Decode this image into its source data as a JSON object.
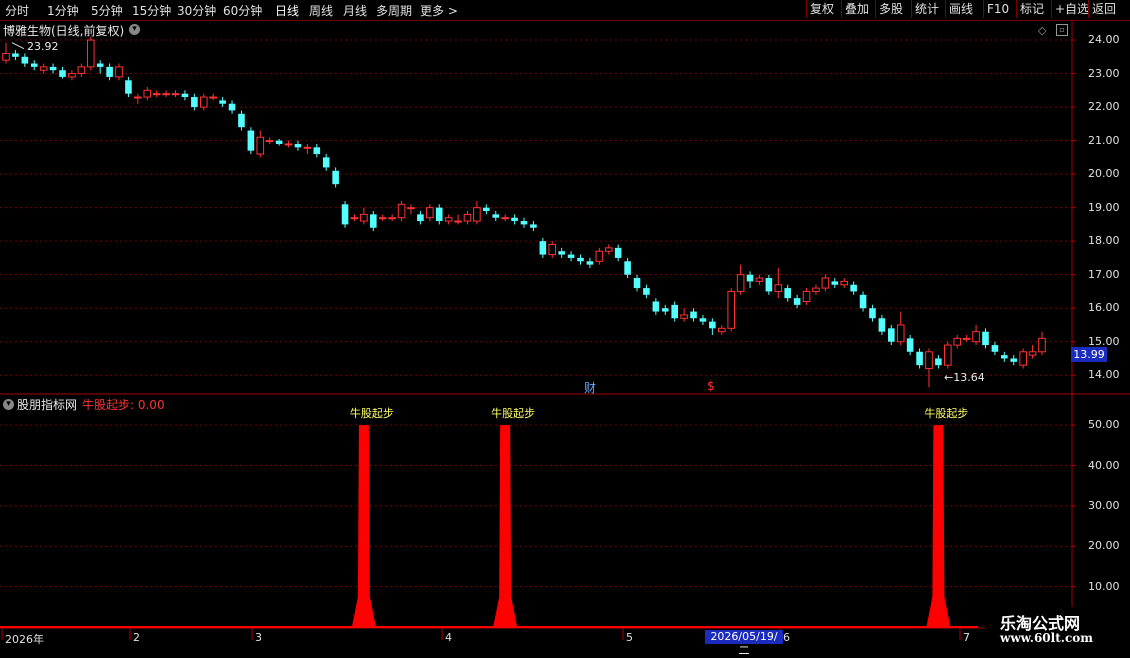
{
  "toolbar": {
    "left_items": [
      "分时",
      "1分钟",
      "5分钟",
      "15分钟",
      "30分钟",
      "60分钟",
      "日线",
      "周线",
      "月线",
      "多周期",
      "更多 >"
    ],
    "active": "日线",
    "right_items": [
      "复权",
      "叠加",
      "多股",
      "统计",
      "画线",
      "F10",
      "标记",
      "+自选",
      "返回"
    ]
  },
  "main_panel": {
    "title": "博雅生物(日线,前复权)",
    "high_marker": "23.92",
    "low_marker": "←13.64",
    "current_price": "13.99",
    "price_ticks": [
      "24.00",
      "23.00",
      "22.00",
      "21.00",
      "20.00",
      "19.00",
      "18.00",
      "17.00",
      "16.00",
      "15.00",
      "14.00"
    ],
    "markers": [
      "财",
      "$"
    ],
    "colors": {
      "up": "#ff3333",
      "down": "#54ffff",
      "grid": "#7a0000"
    }
  },
  "indicator_panel": {
    "name": "股朋指标网",
    "value_label": "牛股起步: 0.00",
    "signal_label": "牛股起步",
    "ticks": [
      "50.00",
      "40.00",
      "30.00",
      "20.00",
      "10.00"
    ],
    "color": "#ff0000"
  },
  "date_axis": {
    "labels": [
      "2026年",
      "2",
      "3",
      "4",
      "5",
      "6",
      "7"
    ],
    "selected": "2026/05/19/二"
  },
  "watermark": {
    "line1": "乐淘公式网",
    "line2": "www.60lt.com"
  },
  "chart_data": {
    "type": "candlestick",
    "ylim": [
      13.5,
      24.3
    ],
    "candles": [
      [
        23.4,
        23.6,
        23.92,
        23.3
      ],
      [
        23.6,
        23.5,
        23.7,
        23.4
      ],
      [
        23.5,
        23.3,
        23.6,
        23.2
      ],
      [
        23.3,
        23.2,
        23.4,
        23.1
      ],
      [
        23.1,
        23.2,
        23.3,
        23.0
      ],
      [
        23.2,
        23.1,
        23.3,
        23.0
      ],
      [
        23.1,
        22.9,
        23.2,
        22.85
      ],
      [
        22.9,
        23.0,
        23.1,
        22.8
      ],
      [
        23.0,
        23.2,
        23.3,
        22.9
      ],
      [
        23.2,
        24.0,
        24.1,
        23.1
      ],
      [
        23.3,
        23.2,
        23.4,
        23.0
      ],
      [
        23.2,
        22.9,
        23.3,
        22.8
      ],
      [
        22.9,
        23.2,
        23.3,
        22.8
      ],
      [
        22.8,
        22.4,
        22.9,
        22.3
      ],
      [
        22.3,
        22.3,
        22.4,
        22.1
      ],
      [
        22.3,
        22.5,
        22.6,
        22.2
      ],
      [
        22.4,
        22.4,
        22.5,
        22.3
      ],
      [
        22.4,
        22.4,
        22.5,
        22.3
      ],
      [
        22.4,
        22.4,
        22.5,
        22.3
      ],
      [
        22.4,
        22.3,
        22.5,
        22.2
      ],
      [
        22.3,
        22.0,
        22.4,
        21.9
      ],
      [
        22.0,
        22.3,
        22.4,
        21.9
      ],
      [
        22.3,
        22.3,
        22.4,
        22.2
      ],
      [
        22.2,
        22.1,
        22.3,
        22.0
      ],
      [
        22.1,
        21.9,
        22.2,
        21.8
      ],
      [
        21.8,
        21.4,
        21.9,
        21.3
      ],
      [
        21.3,
        20.7,
        21.4,
        20.6
      ],
      [
        20.6,
        21.1,
        21.3,
        20.5
      ],
      [
        21.0,
        21.0,
        21.1,
        20.9
      ],
      [
        21.0,
        20.9,
        21.05,
        20.85
      ],
      [
        20.9,
        20.9,
        21.0,
        20.8
      ],
      [
        20.9,
        20.8,
        21.0,
        20.7
      ],
      [
        20.8,
        20.8,
        20.9,
        20.6
      ],
      [
        20.8,
        20.6,
        20.9,
        20.5
      ],
      [
        20.5,
        20.2,
        20.6,
        20.1
      ],
      [
        20.1,
        19.7,
        20.2,
        19.6
      ],
      [
        19.1,
        18.5,
        19.2,
        18.4
      ],
      [
        18.7,
        18.7,
        18.8,
        18.6
      ],
      [
        18.6,
        18.8,
        19.0,
        18.5
      ],
      [
        18.8,
        18.4,
        18.9,
        18.3
      ],
      [
        18.7,
        18.7,
        18.8,
        18.6
      ],
      [
        18.7,
        18.7,
        18.8,
        18.6
      ],
      [
        18.7,
        19.1,
        19.2,
        18.6
      ],
      [
        19.0,
        19.0,
        19.1,
        18.8
      ],
      [
        18.8,
        18.6,
        18.9,
        18.5
      ],
      [
        18.7,
        19.0,
        19.1,
        18.6
      ],
      [
        19.0,
        18.6,
        19.1,
        18.5
      ],
      [
        18.6,
        18.7,
        18.8,
        18.5
      ],
      [
        18.6,
        18.6,
        18.8,
        18.5
      ],
      [
        18.6,
        18.8,
        18.9,
        18.5
      ],
      [
        18.6,
        19.0,
        19.2,
        18.5
      ],
      [
        19.0,
        18.9,
        19.1,
        18.8
      ],
      [
        18.8,
        18.7,
        18.9,
        18.6
      ],
      [
        18.7,
        18.7,
        18.8,
        18.6
      ],
      [
        18.7,
        18.6,
        18.8,
        18.5
      ],
      [
        18.6,
        18.5,
        18.7,
        18.4
      ],
      [
        18.5,
        18.4,
        18.6,
        18.3
      ],
      [
        18.0,
        17.6,
        18.1,
        17.5
      ],
      [
        17.6,
        17.9,
        18.0,
        17.5
      ],
      [
        17.7,
        17.6,
        17.8,
        17.5
      ],
      [
        17.6,
        17.5,
        17.7,
        17.4
      ],
      [
        17.5,
        17.4,
        17.6,
        17.3
      ],
      [
        17.4,
        17.3,
        17.5,
        17.2
      ],
      [
        17.4,
        17.7,
        17.8,
        17.3
      ],
      [
        17.7,
        17.8,
        17.9,
        17.6
      ],
      [
        17.8,
        17.5,
        17.9,
        17.4
      ],
      [
        17.4,
        17.0,
        17.5,
        16.9
      ],
      [
        16.9,
        16.6,
        17.0,
        16.5
      ],
      [
        16.6,
        16.4,
        16.7,
        16.3
      ],
      [
        16.2,
        15.9,
        16.3,
        15.8
      ],
      [
        16.0,
        15.9,
        16.1,
        15.8
      ],
      [
        16.1,
        15.7,
        16.2,
        15.6
      ],
      [
        15.7,
        15.8,
        16.0,
        15.6
      ],
      [
        15.9,
        15.7,
        16.0,
        15.6
      ],
      [
        15.7,
        15.6,
        15.8,
        15.5
      ],
      [
        15.6,
        15.4,
        15.7,
        15.2
      ],
      [
        15.3,
        15.4,
        15.5,
        15.2
      ],
      [
        15.4,
        16.5,
        16.6,
        15.3
      ],
      [
        16.5,
        17.0,
        17.3,
        16.4
      ],
      [
        17.0,
        16.8,
        17.1,
        16.6
      ],
      [
        16.8,
        16.9,
        17.0,
        16.7
      ],
      [
        16.9,
        16.5,
        17.0,
        16.4
      ],
      [
        16.5,
        16.7,
        17.2,
        16.3
      ],
      [
        16.6,
        16.3,
        16.7,
        16.2
      ],
      [
        16.3,
        16.1,
        16.4,
        16.0
      ],
      [
        16.2,
        16.5,
        16.6,
        16.1
      ],
      [
        16.5,
        16.6,
        16.7,
        16.4
      ],
      [
        16.6,
        16.9,
        17.0,
        16.5
      ],
      [
        16.8,
        16.7,
        16.9,
        16.6
      ],
      [
        16.7,
        16.8,
        16.9,
        16.6
      ],
      [
        16.7,
        16.5,
        16.8,
        16.4
      ],
      [
        16.4,
        16.0,
        16.5,
        15.9
      ],
      [
        16.0,
        15.7,
        16.1,
        15.6
      ],
      [
        15.7,
        15.3,
        15.8,
        15.2
      ],
      [
        15.4,
        15.0,
        15.5,
        14.9
      ],
      [
        15.0,
        15.5,
        15.9,
        14.9
      ],
      [
        15.1,
        14.7,
        15.2,
        14.6
      ],
      [
        14.7,
        14.3,
        14.8,
        14.2
      ],
      [
        14.2,
        14.7,
        14.8,
        13.64
      ],
      [
        14.5,
        14.3,
        14.6,
        14.2
      ],
      [
        14.3,
        14.9,
        15.0,
        14.2
      ],
      [
        14.9,
        15.1,
        15.2,
        14.8
      ],
      [
        15.1,
        15.1,
        15.2,
        15.0
      ],
      [
        15.0,
        15.3,
        15.5,
        14.9
      ],
      [
        15.3,
        14.9,
        15.4,
        14.8
      ],
      [
        14.9,
        14.7,
        15.0,
        14.6
      ],
      [
        14.6,
        14.5,
        14.7,
        14.4
      ],
      [
        14.5,
        14.4,
        14.6,
        14.3
      ],
      [
        14.3,
        14.7,
        14.8,
        14.2
      ],
      [
        14.6,
        14.7,
        14.9,
        14.5
      ],
      [
        14.7,
        15.1,
        15.3,
        14.6
      ]
    ],
    "indicator": {
      "name": "牛股起步",
      "ylim": [
        0,
        55
      ],
      "spikes_at_candle_index": [
        38,
        53,
        99
      ],
      "spike_value": 50
    }
  }
}
